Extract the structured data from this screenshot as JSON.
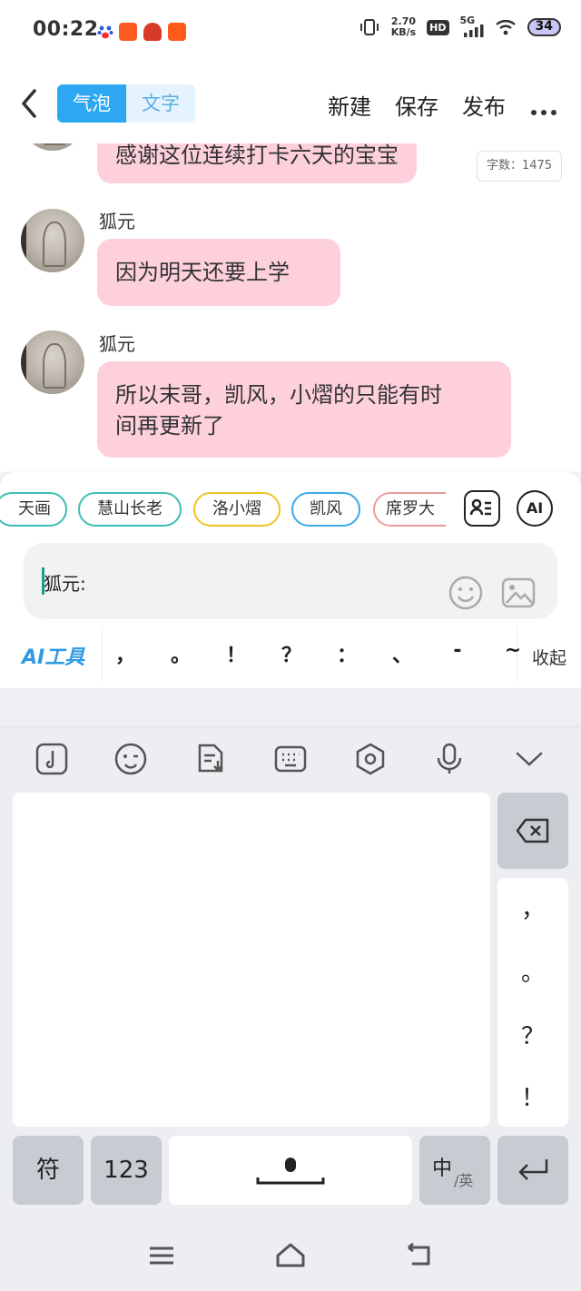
{
  "status_bar": {
    "time": "00:22",
    "net_speed_value": "2.70",
    "net_speed_unit": "KB/s",
    "hd_badge": "HD",
    "network": "5G",
    "battery": "34"
  },
  "top_nav": {
    "mode_tabs": [
      {
        "label": "气泡",
        "active": true
      },
      {
        "label": "文字",
        "active": false
      }
    ],
    "actions": {
      "new": "新建",
      "save": "保存",
      "publish": "发布"
    }
  },
  "chat": {
    "word_count": "字数：1475",
    "messages": [
      {
        "sender": "",
        "text": "感谢这位连续打卡六天的宝宝"
      },
      {
        "sender": "狐元",
        "text": "因为明天还要上学"
      },
      {
        "sender": "狐元",
        "text_line1": "所以末哥，凯风，小熠的只能有时",
        "text_line2": "间再更新了"
      }
    ]
  },
  "characters": [
    {
      "name": "天画",
      "color": "#3dbdb3"
    },
    {
      "name": "慧山长老",
      "color": "#3dbdb3"
    },
    {
      "name": "洛小熠",
      "color": "#f0c322"
    },
    {
      "name": "凯风",
      "color": "#3aa9e6"
    },
    {
      "name": "席罗大",
      "color": "#ec9a9a"
    }
  ],
  "editor": {
    "ai_button": "AI",
    "input_value": "狐元:",
    "ai_tools": "AI工具",
    "punctuation": [
      "，",
      "。",
      "！",
      "？",
      "：",
      "、",
      "-",
      "~"
    ],
    "collapse": "收起"
  },
  "keyboard": {
    "side_punctuation": [
      "，",
      "。",
      "？",
      "！"
    ],
    "symbols_key": "符",
    "numbers_key": "123",
    "lang_key_main": "中",
    "lang_key_sub": "/英"
  },
  "colors": {
    "accent": "#2ea7f3",
    "bubble": "#fdd0dc",
    "ai_tools": "#2f9ae3"
  }
}
